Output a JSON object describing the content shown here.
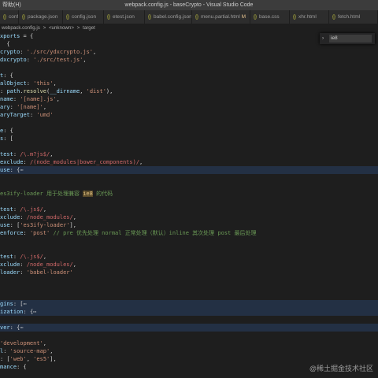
{
  "titlebar": {
    "menu": "帮助(H)",
    "title": "webpack.config.js - baseCrypto - Visual Studio Code"
  },
  "tabs": [
    {
      "label": "config.js",
      "modified": ""
    },
    {
      "label": "package.json",
      "modified": ""
    },
    {
      "label": "config.json",
      "modified": ""
    },
    {
      "label": "etest.json",
      "modified": ""
    },
    {
      "label": "babel.config.json",
      "modified": ""
    },
    {
      "label": "menu.partial.html",
      "modified": "M"
    },
    {
      "label": "base.css",
      "modified": ""
    },
    {
      "label": "xhr.html",
      "modified": ""
    },
    {
      "label": "fetch.html",
      "modified": ""
    }
  ],
  "breadcrumb": {
    "file": "webpack.config.js",
    "sep1": ">",
    "node1": "<unknown>",
    "sep2": ">",
    "node2": "target"
  },
  "find": {
    "value": "ie8"
  },
  "watermark": "@稀土掘金技术社区",
  "code": [
    {
      "hl": false,
      "parts": [
        [
          "k",
          "xports"
        ],
        [
          "p",
          " = {"
        ]
      ]
    },
    {
      "hl": false,
      "parts": [
        [
          "p",
          "  {"
        ]
      ]
    },
    {
      "hl": false,
      "parts": [
        [
          "k",
          "crypto"
        ],
        [
          "p",
          ": "
        ],
        [
          "s",
          "'./src/ydxcrypto.js'"
        ],
        [
          "p",
          ","
        ]
      ]
    },
    {
      "hl": false,
      "parts": [
        [
          "k",
          "dxcrypto"
        ],
        [
          "p",
          ": "
        ],
        [
          "s",
          "'./src/test.js'"
        ],
        [
          "p",
          ","
        ]
      ]
    },
    {
      "hl": false,
      "parts": []
    },
    {
      "hl": false,
      "parts": [
        [
          "k",
          "t"
        ],
        [
          "p",
          ": {"
        ]
      ]
    },
    {
      "hl": false,
      "parts": [
        [
          "k",
          "alObject"
        ],
        [
          "p",
          ": "
        ],
        [
          "s",
          "'this'"
        ],
        [
          "p",
          ","
        ]
      ]
    },
    {
      "hl": false,
      "parts": [
        [
          "p",
          ": "
        ],
        [
          "k",
          "path"
        ],
        [
          "p",
          "."
        ],
        [
          "f",
          "resolve"
        ],
        [
          "p",
          "("
        ],
        [
          "k",
          "__dirname"
        ],
        [
          "p",
          ", "
        ],
        [
          "s",
          "'dist'"
        ],
        [
          "p",
          "),"
        ]
      ]
    },
    {
      "hl": false,
      "parts": [
        [
          "k",
          "name"
        ],
        [
          "p",
          ": "
        ],
        [
          "s",
          "'[name].js'"
        ],
        [
          "p",
          ","
        ]
      ]
    },
    {
      "hl": false,
      "parts": [
        [
          "k",
          "ary"
        ],
        [
          "p",
          ": "
        ],
        [
          "s",
          "'[name]'"
        ],
        [
          "p",
          ","
        ]
      ]
    },
    {
      "hl": false,
      "parts": [
        [
          "k",
          "aryTarget"
        ],
        [
          "p",
          ": "
        ],
        [
          "s",
          "'umd'"
        ]
      ]
    },
    {
      "hl": false,
      "parts": []
    },
    {
      "hl": false,
      "parts": [
        [
          "k",
          "e"
        ],
        [
          "p",
          ": {"
        ]
      ]
    },
    {
      "hl": false,
      "parts": [
        [
          "k",
          "s"
        ],
        [
          "p",
          ": ["
        ]
      ]
    },
    {
      "hl": false,
      "parts": []
    },
    {
      "hl": false,
      "parts": [
        [
          "k",
          "test"
        ],
        [
          "p",
          ": "
        ],
        [
          "r",
          "/\\.m?js$/"
        ],
        [
          "p",
          ","
        ]
      ]
    },
    {
      "hl": false,
      "parts": [
        [
          "k",
          "exclude"
        ],
        [
          "p",
          ": "
        ],
        [
          "r",
          "/(node_modules|bower_components)/"
        ],
        [
          "p",
          ","
        ]
      ]
    },
    {
      "hl": true,
      "parts": [
        [
          "k",
          "use"
        ],
        [
          "p",
          ": {"
        ],
        [
          "ellip",
          "⋯"
        ]
      ]
    },
    {
      "hl": false,
      "parts": []
    },
    {
      "hl": false,
      "parts": []
    },
    {
      "hl": false,
      "parts": [
        [
          "c",
          "es3ify-loader 用于处理兼容 "
        ],
        [
          "marker",
          "ie8"
        ],
        [
          "c",
          " 的代码"
        ]
      ]
    },
    {
      "hl": false,
      "parts": []
    },
    {
      "hl": false,
      "parts": [
        [
          "k",
          "test"
        ],
        [
          "p",
          ": "
        ],
        [
          "r",
          "/\\.js$/"
        ],
        [
          "p",
          ","
        ]
      ]
    },
    {
      "hl": false,
      "parts": [
        [
          "k",
          "xclude"
        ],
        [
          "p",
          ": "
        ],
        [
          "r",
          "/node_modules/"
        ],
        [
          "p",
          ","
        ]
      ]
    },
    {
      "hl": false,
      "parts": [
        [
          "k",
          "use"
        ],
        [
          "p",
          ": ["
        ],
        [
          "s",
          "'es3ify-loader'"
        ],
        [
          "p",
          "],"
        ]
      ]
    },
    {
      "hl": false,
      "parts": [
        [
          "k",
          "enforce"
        ],
        [
          "p",
          ": "
        ],
        [
          "s",
          "'post'"
        ],
        [
          "c",
          " // pre 优先处理 normal 正常处理（默认）inline 其次处理 post 最后处理"
        ]
      ]
    },
    {
      "hl": false,
      "parts": []
    },
    {
      "hl": false,
      "parts": []
    },
    {
      "hl": false,
      "parts": [
        [
          "k",
          "test"
        ],
        [
          "p",
          ": "
        ],
        [
          "r",
          "/\\.js$/"
        ],
        [
          "p",
          ","
        ]
      ]
    },
    {
      "hl": false,
      "parts": [
        [
          "k",
          "xclude"
        ],
        [
          "p",
          ": "
        ],
        [
          "r",
          "/node_modules/"
        ],
        [
          "p",
          ","
        ]
      ]
    },
    {
      "hl": false,
      "parts": [
        [
          "k",
          "loader"
        ],
        [
          "p",
          ": "
        ],
        [
          "s",
          "'babel-loader'"
        ]
      ]
    },
    {
      "hl": false,
      "parts": []
    },
    {
      "hl": false,
      "parts": []
    },
    {
      "hl": false,
      "parts": []
    },
    {
      "hl": true,
      "parts": [
        [
          "k",
          "gins"
        ],
        [
          "p",
          ": ["
        ],
        [
          "ellip",
          "⋯"
        ]
      ]
    },
    {
      "hl": true,
      "parts": [
        [
          "k",
          "ization"
        ],
        [
          "p",
          ": {"
        ],
        [
          "ellip",
          "⋯"
        ]
      ]
    },
    {
      "hl": false,
      "parts": []
    },
    {
      "hl": true,
      "parts": [
        [
          "k",
          "ver"
        ],
        [
          "p",
          ": {"
        ],
        [
          "ellip",
          "⋯"
        ]
      ]
    },
    {
      "hl": false,
      "parts": []
    },
    {
      "hl": false,
      "parts": [
        [
          "s",
          "'development'"
        ],
        [
          "p",
          ","
        ]
      ]
    },
    {
      "hl": false,
      "parts": [
        [
          "k",
          "l"
        ],
        [
          "p",
          ": "
        ],
        [
          "s",
          "'source-map'"
        ],
        [
          "p",
          ","
        ]
      ]
    },
    {
      "hl": false,
      "parts": [
        [
          "p",
          ": ["
        ],
        [
          "s",
          "'web'"
        ],
        [
          "p",
          ", "
        ],
        [
          "s",
          "'es5'"
        ],
        [
          "p",
          "],"
        ]
      ]
    },
    {
      "hl": false,
      "parts": [
        [
          "k",
          "mance"
        ],
        [
          "p",
          ": {"
        ]
      ]
    }
  ]
}
